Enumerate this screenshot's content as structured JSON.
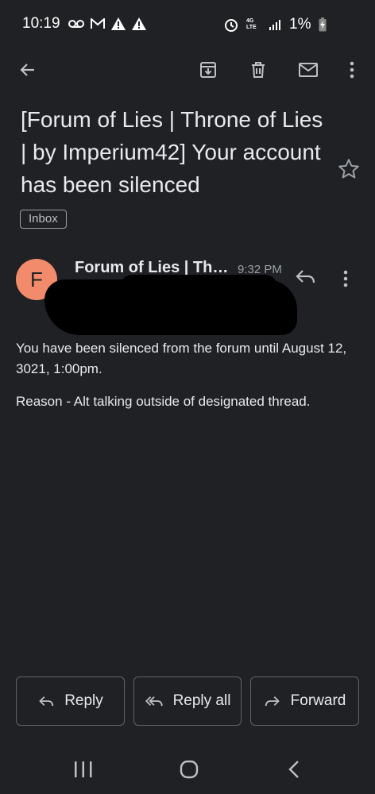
{
  "status_bar": {
    "time": "10:19",
    "battery": "1%",
    "network": "4G LTE"
  },
  "toolbar": {
    "back": "arrow-back-icon",
    "archive": "archive-icon",
    "delete": "trash-icon",
    "mark_unread": "mail-icon",
    "more": "more-vert-icon"
  },
  "email": {
    "subject": "[Forum of Lies | Throne of Lies | by Imperium42] Your account has been silenced",
    "label": "Inbox",
    "sender_initial": "F",
    "sender_name": "Forum of Lies | Throne of Lies",
    "time": "9:32 PM",
    "body": [
      "You have been silenced from the forum until August 12, 3021, 1:00pm.",
      "Reason - Alt talking outside of designated thread."
    ]
  },
  "actions": {
    "reply": "Reply",
    "reply_all": "Reply all",
    "forward": "Forward"
  },
  "colors": {
    "background": "#202124",
    "avatar": "#f28b6b",
    "text": "#e8eaed",
    "muted": "#9aa0a6"
  }
}
